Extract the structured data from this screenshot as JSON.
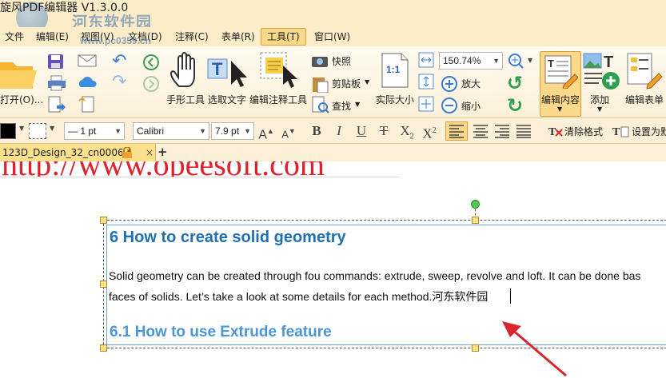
{
  "title": "旋风PDF编辑器 V1.3.0.0",
  "watermark": {
    "site": "河东软件园",
    "url": "www.pc0359.cn"
  },
  "menu": [
    "文件",
    "编辑(E)",
    "视图(V)",
    "文档(D)",
    "注释(C)",
    "表单(R)",
    "工具(T)",
    "窗口(W)"
  ],
  "active_menu": "工具(T)",
  "ribbon": {
    "open": "打开(O)...",
    "hand": "手形工具",
    "select_text": "选取文字",
    "edit_annot": "编辑注释工具",
    "snapshot": "快照",
    "clipboard": "剪贴板",
    "find": "查找",
    "actual_size": "实际大小",
    "zoom_value": "150.74%",
    "zoom_in": "放大",
    "zoom_out": "缩小",
    "edit_content": "编辑内容",
    "add": "添加",
    "edit_form": "编辑表单",
    "actual_icon_text": "1:1"
  },
  "format_bar": {
    "line_width": "— 1 pt",
    "font": "Calibri",
    "font_size": "7.9 pt",
    "clear_format": "清除格式",
    "set_as": "设置为默"
  },
  "tab": {
    "name": "123D_Design_32_cn0006 *"
  },
  "document": {
    "top_url": "http://www.opeesoft.com",
    "heading": "6      How to create solid geometry",
    "line1": "Solid geometry can be created through fou commands: extrude, sweep, revolve and loft. It can be done bas",
    "line2": "faces of solids. Let’s take a look at some details for each method.河东软件园",
    "subheading": "6.1      How to use Extrude feature"
  },
  "colors": {
    "accent": "#fbe08e",
    "heading": "#1f6fb5",
    "arrow": "#d9262c"
  }
}
